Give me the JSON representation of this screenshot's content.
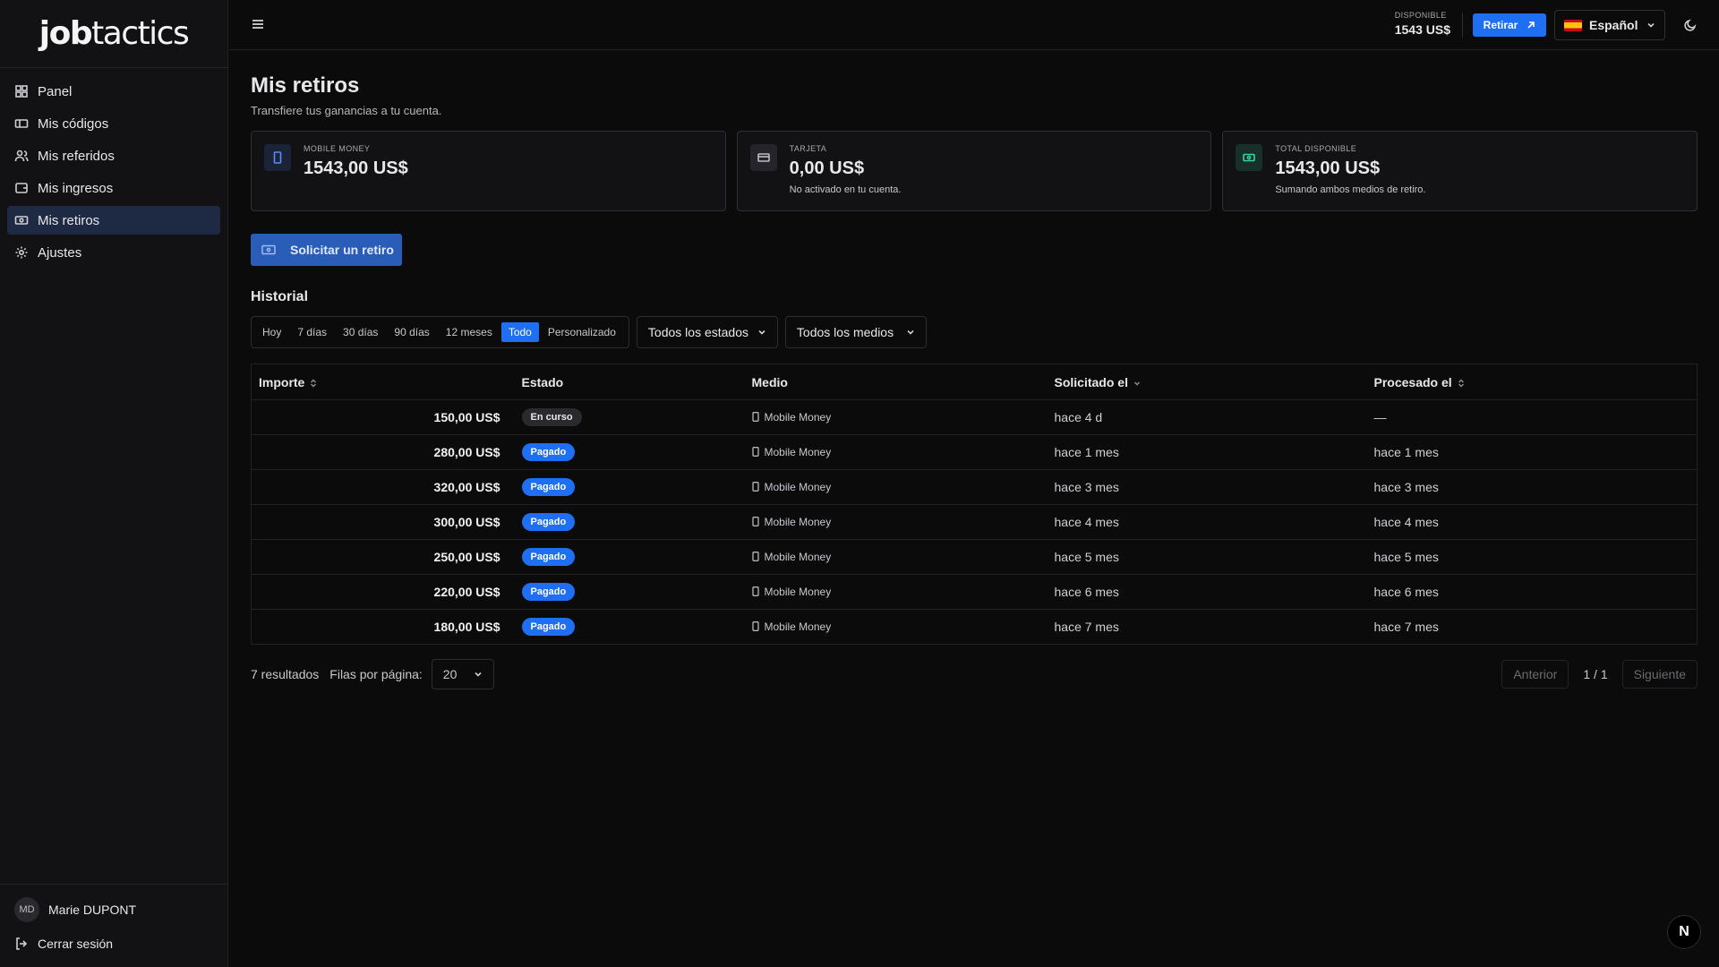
{
  "brand": {
    "logo_bold": "job",
    "logo_light": "tactics"
  },
  "sidebar": {
    "items": [
      {
        "label": "Panel",
        "icon": "grid-icon"
      },
      {
        "label": "Mis códigos",
        "icon": "ticket-icon"
      },
      {
        "label": "Mis referidos",
        "icon": "users-icon"
      },
      {
        "label": "Mis ingresos",
        "icon": "wallet-icon"
      },
      {
        "label": "Mis retiros",
        "icon": "banknote-icon",
        "active": true
      },
      {
        "label": "Ajustes",
        "icon": "gear-icon"
      }
    ],
    "user": {
      "initials": "MD",
      "name": "Marie DUPONT"
    },
    "logout_label": "Cerrar sesión"
  },
  "topbar": {
    "available_label": "DISPONIBLE",
    "available_value": "1543 US$",
    "withdraw_label": "Retirar",
    "language": "Español"
  },
  "page": {
    "title": "Mis retiros",
    "subtitle": "Transfiere tus ganancias a tu cuenta."
  },
  "cards": [
    {
      "label": "MOBILE MONEY",
      "value": "1543,00 US$",
      "desc": ""
    },
    {
      "label": "TARJETA",
      "value": "0,00 US$",
      "desc": "No activado en tu cuenta."
    },
    {
      "label": "TOTAL DISPONIBLE",
      "value": "1543,00 US$",
      "desc": "Sumando ambos medios de retiro."
    }
  ],
  "request_button": "Solicitar un retiro",
  "history": {
    "title": "Historial",
    "periods": [
      "Hoy",
      "7 días",
      "30 días",
      "90 días",
      "12 meses",
      "Todo",
      "Personalizado"
    ],
    "active_period": "Todo",
    "status_filter": "Todos los estados",
    "medium_filter": "Todos los medios",
    "columns": [
      "Importe",
      "Estado",
      "Medio",
      "Solicitado el",
      "Procesado el"
    ],
    "rows": [
      {
        "amount": "150,00 US$",
        "status": "En curso",
        "medium": "Mobile Money",
        "requested": "hace 4 d",
        "processed": "—"
      },
      {
        "amount": "280,00 US$",
        "status": "Pagado",
        "medium": "Mobile Money",
        "requested": "hace 1 mes",
        "processed": "hace 1 mes"
      },
      {
        "amount": "320,00 US$",
        "status": "Pagado",
        "medium": "Mobile Money",
        "requested": "hace 3 mes",
        "processed": "hace 3 mes"
      },
      {
        "amount": "300,00 US$",
        "status": "Pagado",
        "medium": "Mobile Money",
        "requested": "hace 4 mes",
        "processed": "hace 4 mes"
      },
      {
        "amount": "250,00 US$",
        "status": "Pagado",
        "medium": "Mobile Money",
        "requested": "hace 5 mes",
        "processed": "hace 5 mes"
      },
      {
        "amount": "220,00 US$",
        "status": "Pagado",
        "medium": "Mobile Money",
        "requested": "hace 6 mes",
        "processed": "hace 6 mes"
      },
      {
        "amount": "180,00 US$",
        "status": "Pagado",
        "medium": "Mobile Money",
        "requested": "hace 7 mes",
        "processed": "hace 7 mes"
      }
    ]
  },
  "pagination": {
    "results": "7 resultados",
    "rows_label": "Filas por página:",
    "rows_value": "20",
    "prev": "Anterior",
    "info": "1 / 1",
    "next": "Siguiente"
  },
  "floating_badge": "N",
  "colors": {
    "accent": "#1f6ff2",
    "background": "#0b0b0c",
    "sidebar": "#121214"
  }
}
